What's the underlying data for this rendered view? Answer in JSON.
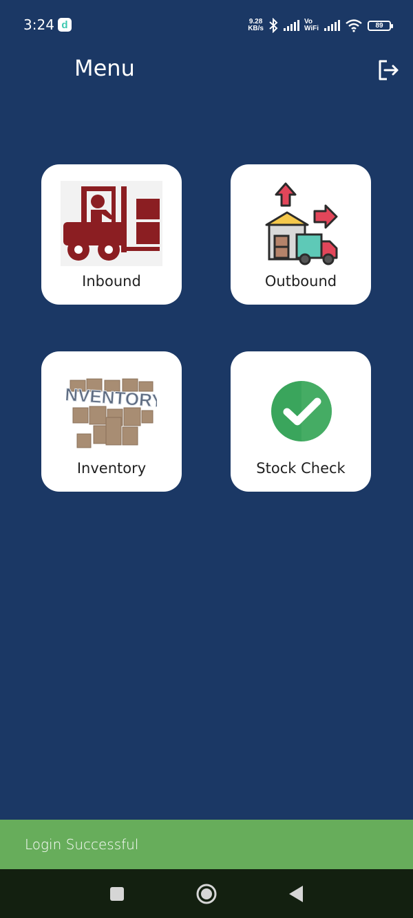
{
  "status_bar": {
    "time": "3:24",
    "app_icon_letter": "d",
    "net_speed_value": "9.28",
    "net_speed_unit": "KB/s",
    "vo_label": "Vo",
    "wifi_label": "WiFi",
    "battery": "89"
  },
  "header": {
    "title": "Menu",
    "logout_icon": "logout-icon"
  },
  "menu": {
    "items": [
      {
        "label": "Inbound",
        "icon": "forklift-icon",
        "color": "#8b1e22"
      },
      {
        "label": "Outbound",
        "icon": "warehouse-truck-icon",
        "color": "#5ec9b7"
      },
      {
        "label": "Inventory",
        "icon": "inventory-boxes-icon",
        "color": "#a88d73"
      },
      {
        "label": "Stock Check",
        "icon": "check-circle-icon",
        "color": "#3aa55c"
      }
    ]
  },
  "snackbar": {
    "message": "Login Successful",
    "color": "#67ad5b"
  },
  "nav_bar": {
    "buttons": [
      "recents-icon",
      "home-icon",
      "back-icon"
    ]
  },
  "colors": {
    "background": "#1b3865",
    "card": "#ffffff"
  }
}
